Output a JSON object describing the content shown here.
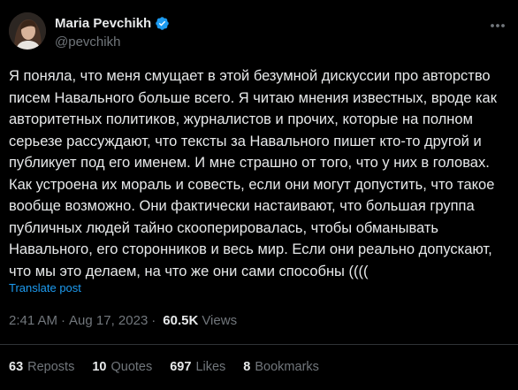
{
  "author": {
    "display_name": "Maria Pevchikh",
    "handle": "@pevchikh",
    "verified": true
  },
  "tweet": {
    "text": "Я поняла, что меня смущает в этой безумной дискуссии про авторство\nписем Навального больше всего. Я читаю мнения известных, вроде как\nавторитетных политиков, журналистов и прочих, которые на полном\nсерьезе рассуждают, что тексты за Навального пишет кто-то другой и\nпубликует под его именем. И мне страшно от того, что у них в головах.\nКак устроена их мораль и совесть, если они могут допустить, что такое\nвообще возможно. Они фактически настаивают, что большая группа\nпубличных людей тайно скооперировалась, чтобы обманывать\nНавального, его сторонников и весь мир. Если они реально допускают,\nчто мы это делаем, на что же они сами способны ((((",
    "translate_label": "Translate post",
    "time": "2:41 AM",
    "separator": "·",
    "date": "Aug 17, 2023",
    "views_count": "60.5K",
    "views_label": "Views"
  },
  "stats": {
    "reposts": {
      "count": "63",
      "label": "Reposts"
    },
    "quotes": {
      "count": "10",
      "label": "Quotes"
    },
    "likes": {
      "count": "697",
      "label": "Likes"
    },
    "bookmarks": {
      "count": "8",
      "label": "Bookmarks"
    }
  },
  "colors": {
    "background": "#000000",
    "text": "#e7e9ea",
    "muted": "#71767b",
    "accent": "#1d9bf0",
    "divider": "#2f3336"
  },
  "icons": {
    "verified": "verified-badge-icon",
    "more": "more-icon"
  }
}
